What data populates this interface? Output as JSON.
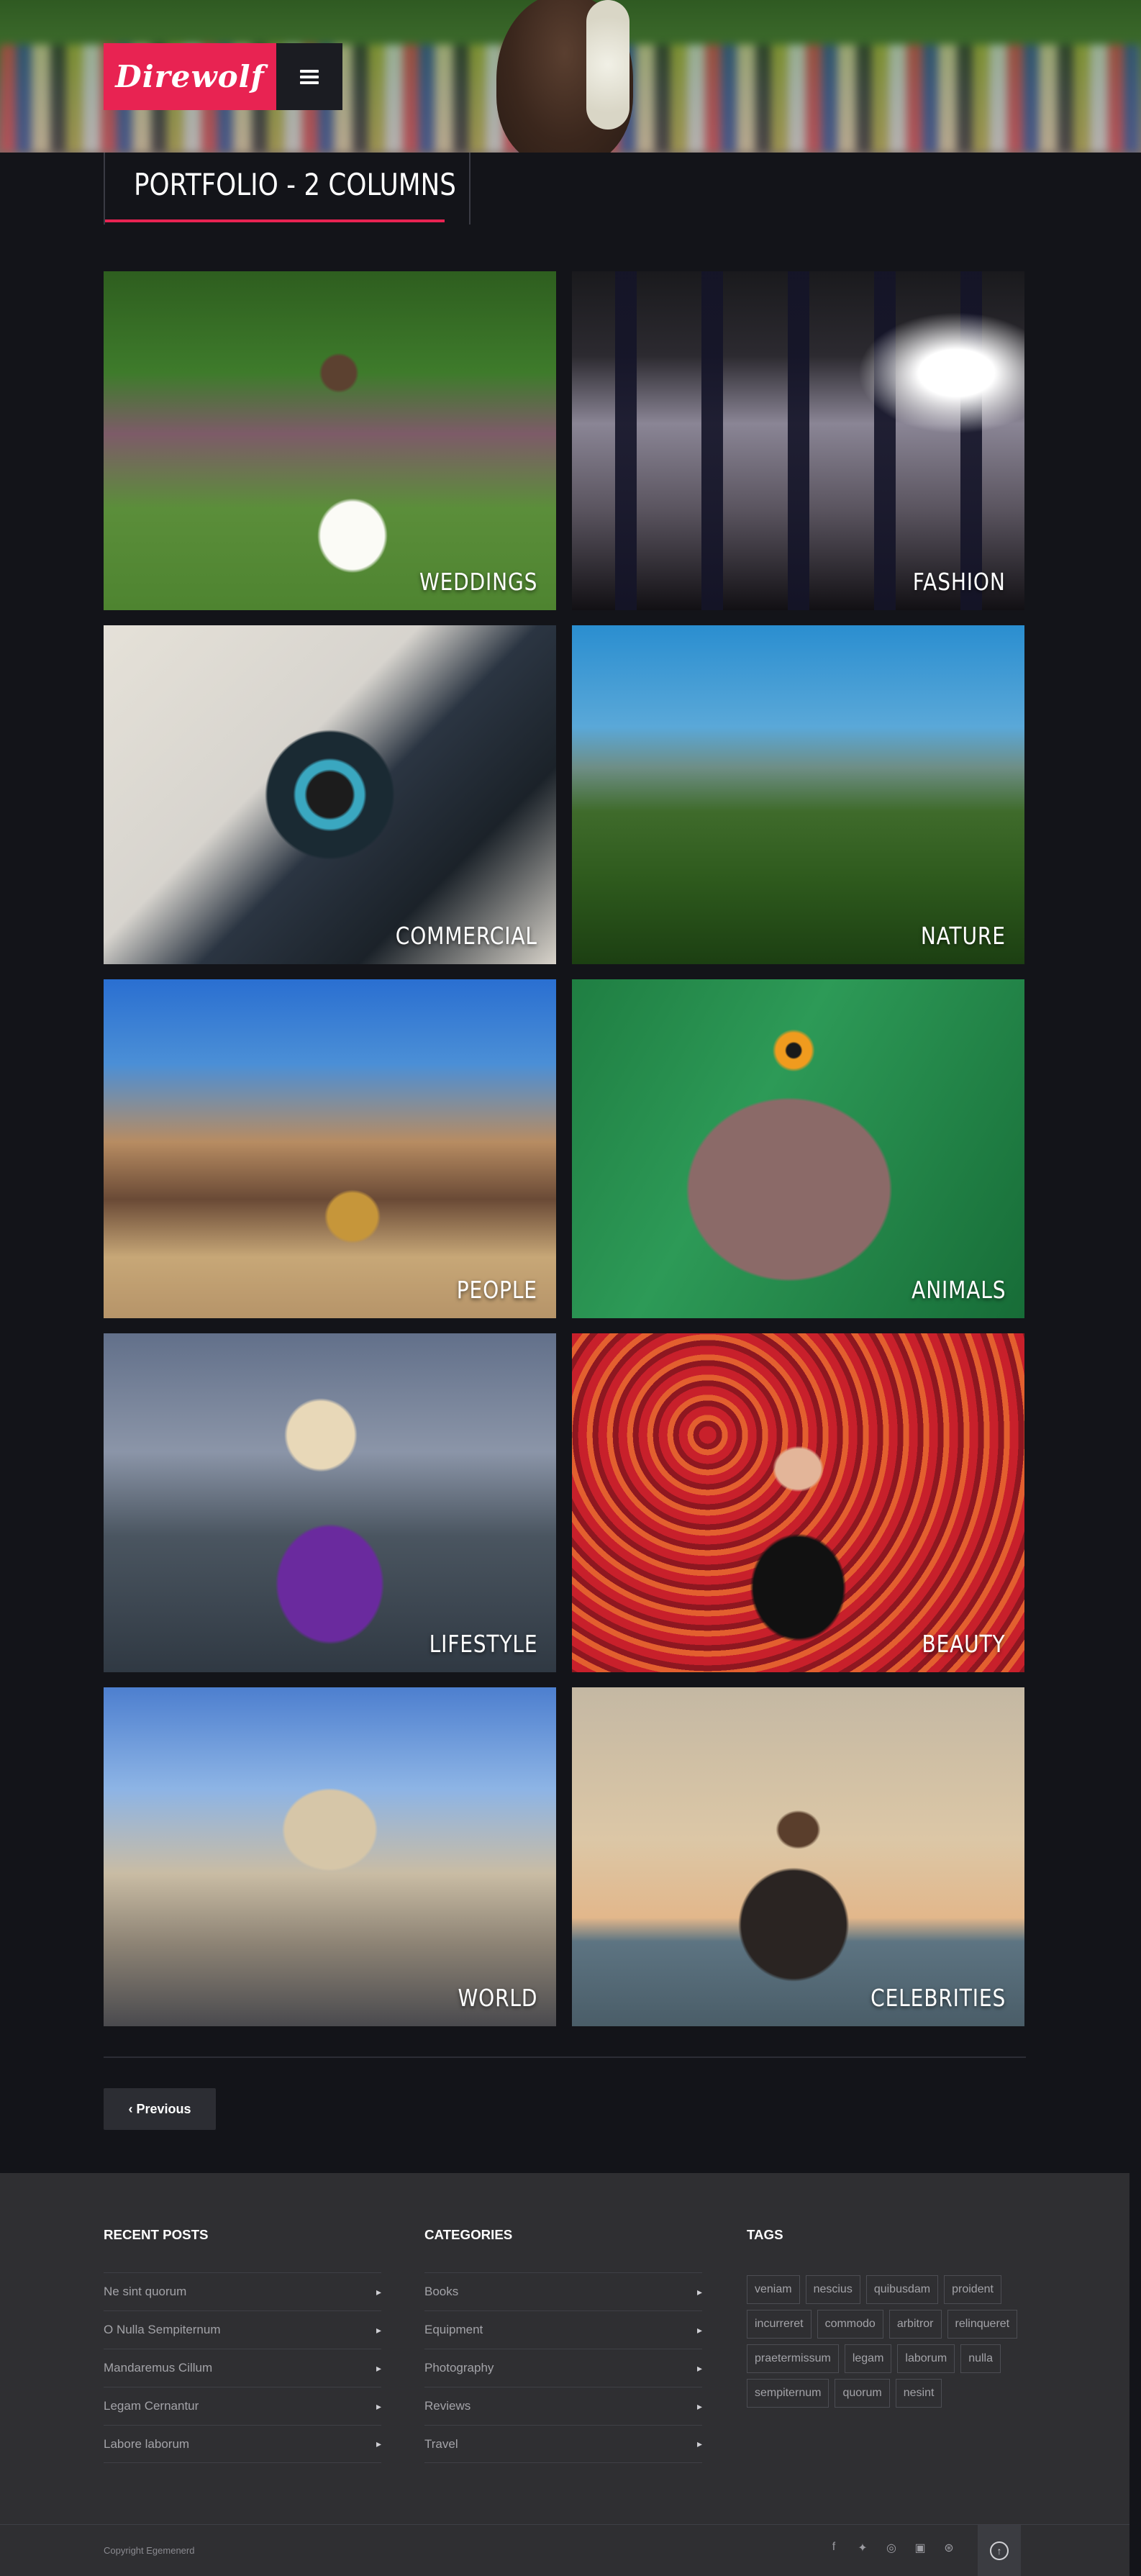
{
  "brand": {
    "logo_text": "Direwolf",
    "accent_color": "#e82352"
  },
  "header": {
    "menu_icon": "hamburger-icon"
  },
  "page": {
    "title": "PORTFOLIO - 2 COLUMNS"
  },
  "portfolio": {
    "items": [
      {
        "label": "WEDDINGS"
      },
      {
        "label": "FASHION"
      },
      {
        "label": "COMMERCIAL"
      },
      {
        "label": "NATURE"
      },
      {
        "label": "PEOPLE"
      },
      {
        "label": "ANIMALS"
      },
      {
        "label": "LIFESTYLE"
      },
      {
        "label": "BEAUTY"
      },
      {
        "label": "WORLD"
      },
      {
        "label": "CELEBRITIES"
      }
    ]
  },
  "pagination": {
    "previous_label": "‹ Previous"
  },
  "footer": {
    "recent_posts": {
      "heading": "RECENT POSTS",
      "items": [
        "Ne sint quorum",
        "O Nulla Sempiternum",
        "Mandaremus Cillum",
        "Legam Cernantur",
        "Labore laborum"
      ]
    },
    "categories": {
      "heading": "CATEGORIES",
      "items": [
        "Books",
        "Equipment",
        "Photography",
        "Reviews",
        "Travel"
      ]
    },
    "tags": {
      "heading": "TAGS",
      "items": [
        "veniam",
        "nescius",
        "quibusdam",
        "proident",
        "incurreret",
        "commodo",
        "arbitror",
        "relinqueret",
        "praetermissum",
        "legam",
        "laborum",
        "nulla",
        "sempiternum",
        "quorum",
        "nesint"
      ]
    },
    "copyright": "Copyright Egemenerd",
    "social_icons": [
      "facebook-icon",
      "twitter-icon",
      "instagram-icon",
      "linkedin-icon",
      "pinterest-icon"
    ]
  }
}
